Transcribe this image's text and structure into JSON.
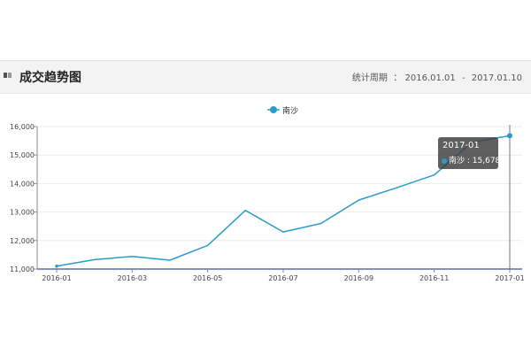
{
  "header": {
    "title": "成交趋势图",
    "period_label": "统计周期",
    "period_start": "2016.01.01",
    "period_end": "2017.01.10"
  },
  "tooltip": {
    "date": "2017-01",
    "series_name": "南沙",
    "value_text": "15,678"
  },
  "chart_data": {
    "type": "line",
    "title": "",
    "xlabel": "",
    "ylabel": "",
    "x": [
      "2016-01",
      "2016-02",
      "2016-03",
      "2016-04",
      "2016-05",
      "2016-06",
      "2016-07",
      "2016-08",
      "2016-09",
      "2016-10",
      "2016-11",
      "2016-12",
      "2017-01"
    ],
    "x_tick_labels": [
      "2016-01",
      "2016-03",
      "2016-05",
      "2016-07",
      "2016-09",
      "2016-11",
      "2017-01"
    ],
    "ylim": [
      11000,
      16000
    ],
    "y_ticks": [
      11000,
      12000,
      13000,
      14000,
      15000,
      16000
    ],
    "y_tick_labels": [
      "11,000",
      "12,000",
      "13,000",
      "14,000",
      "15,000",
      "16,000"
    ],
    "series": [
      {
        "name": "南沙",
        "color": "#2b9bc9",
        "values": [
          11100,
          11330,
          11440,
          11310,
          11830,
          13060,
          12300,
          12600,
          13420,
          13850,
          14300,
          15450,
          15678
        ]
      }
    ],
    "grid": true,
    "legend": "top-center",
    "highlight_index": 12
  }
}
